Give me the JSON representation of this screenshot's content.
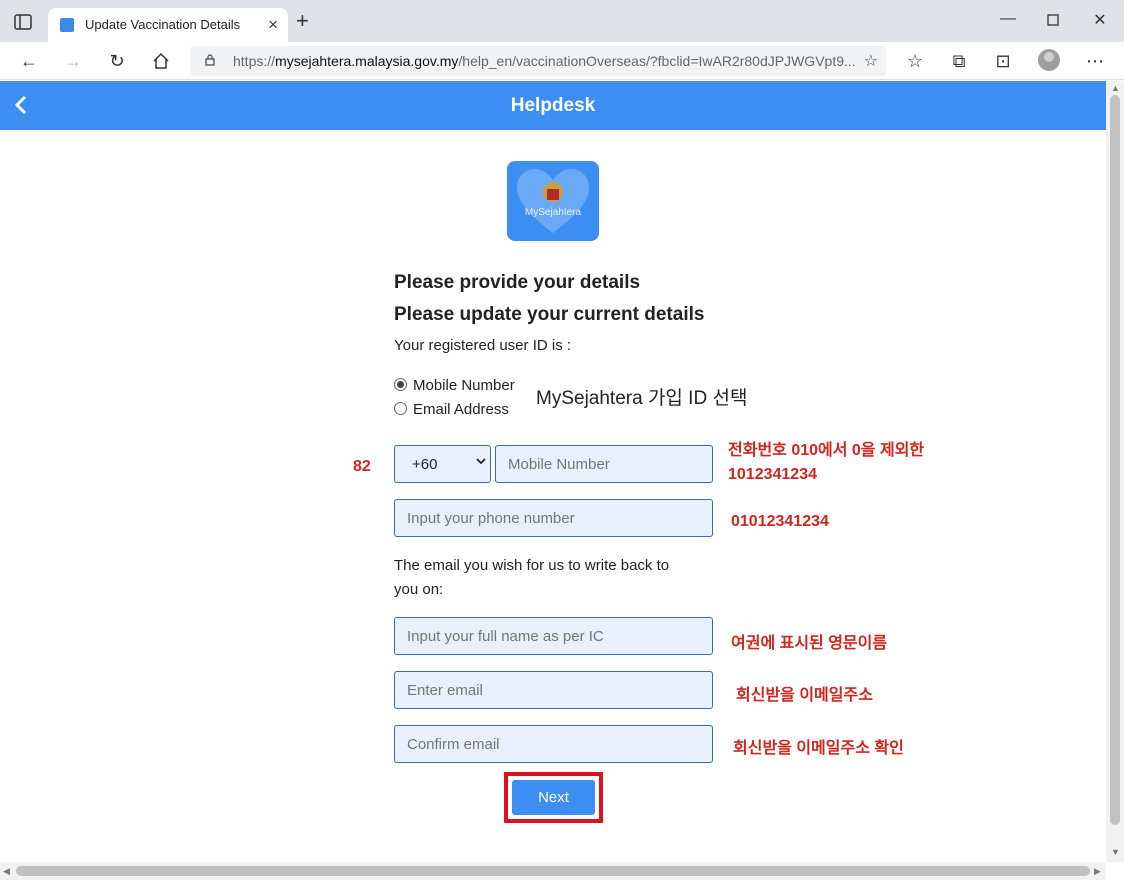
{
  "browser": {
    "tab_title": "Update Vaccination Details",
    "url_prefix": "https://",
    "url_host": "mysejahtera.malaysia.gov.my",
    "url_path": "/help_en/vaccinationOverseas/?fbclid=IwAR2r80dJPJWGVpt9..."
  },
  "header": {
    "title": "Helpdesk",
    "back_glyph": "<"
  },
  "logo": {
    "text": "MySejahtera"
  },
  "form": {
    "heading1": "Please provide your details",
    "heading2": "Please update your current details",
    "registered_label": "Your registered user ID is :",
    "radio_mobile": "Mobile Number",
    "radio_email": "Email Address",
    "country_code": "+60",
    "mobile_placeholder": "Mobile Number",
    "phone_placeholder": "Input your phone number",
    "email_prompt_line1": "The email you wish for us to write back to",
    "email_prompt_line2": "you on:",
    "fullname_placeholder": "Input your full name as per IC",
    "email_placeholder": "Enter email",
    "confirm_email_placeholder": "Confirm email",
    "next_label": "Next"
  },
  "annotations": {
    "select_id": "MySejahtera 가입 ID 선택",
    "country_code_note": "82",
    "mobile_note_line1": "전화번호 010에서 0을 제외한",
    "mobile_note_line2": "1012341234",
    "phone_note": "01012341234",
    "name_note": "여권에 표시된 영문이름",
    "email_note": "회신받을 이메일주소",
    "confirm_note": "회신받을 이메일주소 확인"
  }
}
